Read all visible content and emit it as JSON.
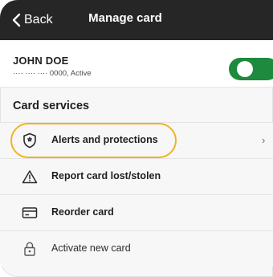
{
  "header": {
    "back_label": "Back",
    "title": "Manage card"
  },
  "account": {
    "holder_name": "JOHN DOE",
    "card_status_line": "···· ···· ···· 0000, Active",
    "toggle_on": true
  },
  "services": {
    "section_title": "Card services",
    "items": [
      {
        "label": "Alerts and protections",
        "icon": "shield-icon",
        "chevron": "›",
        "highlighted": true
      },
      {
        "label": "Report card lost/stolen",
        "icon": "warning-triangle-icon"
      },
      {
        "label": "Reorder card",
        "icon": "credit-card-icon"
      },
      {
        "label": "Activate new card",
        "icon": "lock-icon"
      }
    ]
  },
  "colors": {
    "header_bg": "#262626",
    "toggle_on": "#1e8a3e",
    "highlight_ring": "#f0b323"
  }
}
